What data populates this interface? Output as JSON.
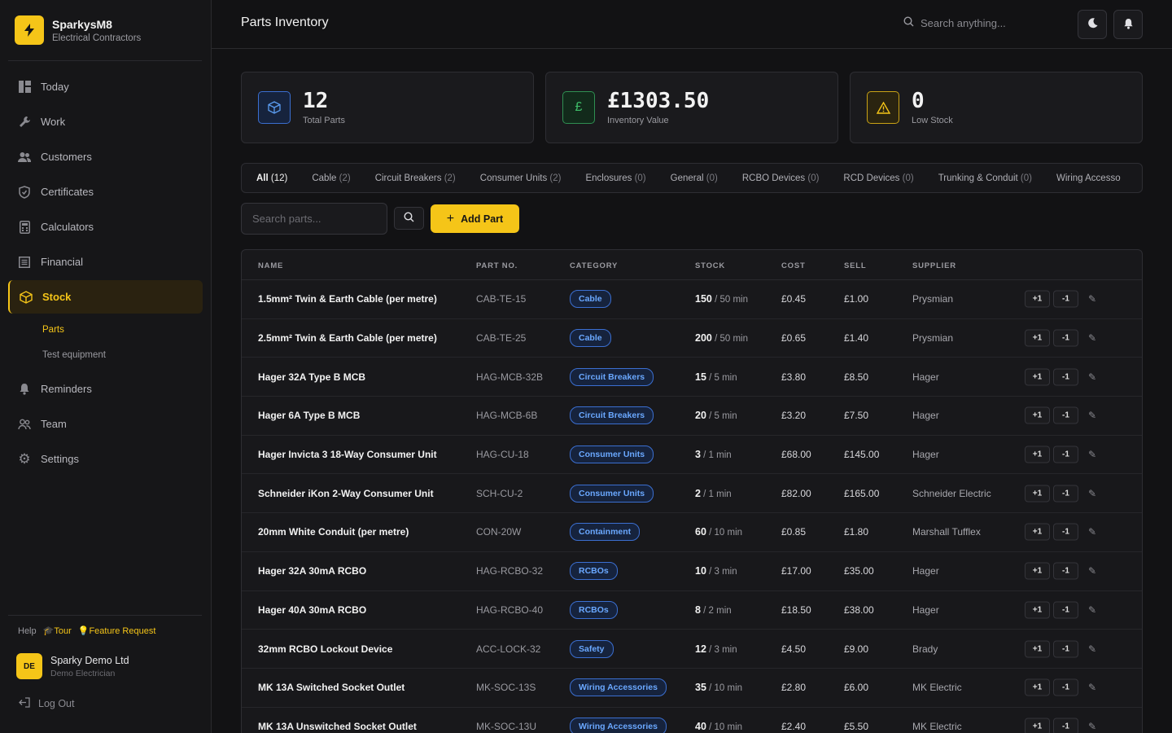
{
  "brand": {
    "name": "SparkysM8",
    "subtitle": "Electrical Contractors"
  },
  "nav": [
    {
      "label": "Today",
      "icon": "dashboard-icon"
    },
    {
      "label": "Work",
      "icon": "wrench-icon"
    },
    {
      "label": "Customers",
      "icon": "users-icon"
    },
    {
      "label": "Certificates",
      "icon": "shield-icon"
    },
    {
      "label": "Calculators",
      "icon": "calculator-icon"
    },
    {
      "label": "Financial",
      "icon": "ledger-icon"
    },
    {
      "label": "Stock",
      "icon": "box-icon",
      "active": true
    },
    {
      "label": "Reminders",
      "icon": "bell-icon"
    },
    {
      "label": "Team",
      "icon": "team-icon"
    },
    {
      "label": "Settings",
      "icon": "gear-icon"
    }
  ],
  "subnav": [
    {
      "label": "Parts",
      "active": true
    },
    {
      "label": "Test equipment"
    }
  ],
  "help": {
    "label": "Help",
    "tour": "Tour",
    "feature": "Feature Request"
  },
  "user": {
    "initials": "DE",
    "name": "Sparky Demo Ltd",
    "role": "Demo Electrician"
  },
  "logout": "Log Out",
  "header": {
    "title": "Parts Inventory",
    "search_placeholder": "Search anything..."
  },
  "stats": {
    "total": {
      "value": "12",
      "label": "Total Parts"
    },
    "value": {
      "value": "£1303.50",
      "label": "Inventory Value"
    },
    "low": {
      "value": "0",
      "label": "Low Stock"
    }
  },
  "tabs": [
    {
      "label": "All",
      "count": "(12)",
      "active": true
    },
    {
      "label": "Cable",
      "count": "(2)"
    },
    {
      "label": "Circuit Breakers",
      "count": "(2)"
    },
    {
      "label": "Consumer Units",
      "count": "(2)"
    },
    {
      "label": "Enclosures",
      "count": "(0)"
    },
    {
      "label": "General",
      "count": "(0)"
    },
    {
      "label": "RCBO Devices",
      "count": "(0)"
    },
    {
      "label": "RCD Devices",
      "count": "(0)"
    },
    {
      "label": "Trunking & Conduit",
      "count": "(0)"
    },
    {
      "label": "Wiring Accesso",
      "count": ""
    }
  ],
  "toolbar": {
    "search_placeholder": "Search parts...",
    "add_label": "Add Part"
  },
  "table": {
    "columns": [
      "NAME",
      "PART NO.",
      "CATEGORY",
      "STOCK",
      "COST",
      "SELL",
      "SUPPLIER"
    ],
    "plus_label": "+1",
    "minus_label": "-1",
    "rows": [
      {
        "name": "1.5mm² Twin & Earth Cable (per metre)",
        "part": "CAB-TE-15",
        "category": "Cable",
        "stock": "150",
        "min": "/ 50 min",
        "cost": "£0.45",
        "sell": "£1.00",
        "supplier": "Prysmian"
      },
      {
        "name": "2.5mm² Twin & Earth Cable (per metre)",
        "part": "CAB-TE-25",
        "category": "Cable",
        "stock": "200",
        "min": "/ 50 min",
        "cost": "£0.65",
        "sell": "£1.40",
        "supplier": "Prysmian"
      },
      {
        "name": "Hager 32A Type B MCB",
        "part": "HAG-MCB-32B",
        "category": "Circuit Breakers",
        "stock": "15",
        "min": "/ 5 min",
        "cost": "£3.80",
        "sell": "£8.50",
        "supplier": "Hager"
      },
      {
        "name": "Hager 6A Type B MCB",
        "part": "HAG-MCB-6B",
        "category": "Circuit Breakers",
        "stock": "20",
        "min": "/ 5 min",
        "cost": "£3.20",
        "sell": "£7.50",
        "supplier": "Hager"
      },
      {
        "name": "Hager Invicta 3 18-Way Consumer Unit",
        "part": "HAG-CU-18",
        "category": "Consumer Units",
        "stock": "3",
        "min": "/ 1 min",
        "cost": "£68.00",
        "sell": "£145.00",
        "supplier": "Hager"
      },
      {
        "name": "Schneider iKon 2-Way Consumer Unit",
        "part": "SCH-CU-2",
        "category": "Consumer Units",
        "stock": "2",
        "min": "/ 1 min",
        "cost": "£82.00",
        "sell": "£165.00",
        "supplier": "Schneider Electric"
      },
      {
        "name": "20mm White Conduit (per metre)",
        "part": "CON-20W",
        "category": "Containment",
        "stock": "60",
        "min": "/ 10 min",
        "cost": "£0.85",
        "sell": "£1.80",
        "supplier": "Marshall Tufflex"
      },
      {
        "name": "Hager 32A 30mA RCBO",
        "part": "HAG-RCBO-32",
        "category": "RCBOs",
        "stock": "10",
        "min": "/ 3 min",
        "cost": "£17.00",
        "sell": "£35.00",
        "supplier": "Hager"
      },
      {
        "name": "Hager 40A 30mA RCBO",
        "part": "HAG-RCBO-40",
        "category": "RCBOs",
        "stock": "8",
        "min": "/ 2 min",
        "cost": "£18.50",
        "sell": "£38.00",
        "supplier": "Hager"
      },
      {
        "name": "32mm RCBO Lockout Device",
        "part": "ACC-LOCK-32",
        "category": "Safety",
        "stock": "12",
        "min": "/ 3 min",
        "cost": "£4.50",
        "sell": "£9.00",
        "supplier": "Brady"
      },
      {
        "name": "MK 13A Switched Socket Outlet",
        "part": "MK-SOC-13S",
        "category": "Wiring Accessories",
        "stock": "35",
        "min": "/ 10 min",
        "cost": "£2.80",
        "sell": "£6.00",
        "supplier": "MK Electric"
      },
      {
        "name": "MK 13A Unswitched Socket Outlet",
        "part": "MK-SOC-13U",
        "category": "Wiring Accessories",
        "stock": "40",
        "min": "/ 10 min",
        "cost": "£2.40",
        "sell": "£5.50",
        "supplier": "MK Electric"
      }
    ]
  },
  "colors": {
    "accent": "#f5c518",
    "category": "#6aa8ff",
    "total_icon": "#5b9cf0",
    "value_icon": "#3fbf6a",
    "low_icon": "#f5c518"
  }
}
